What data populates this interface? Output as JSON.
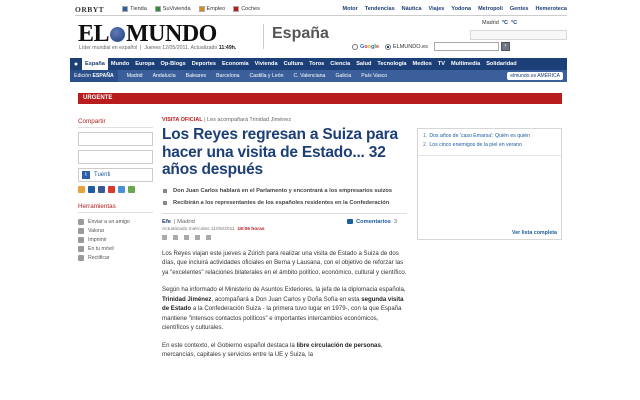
{
  "topbar": {
    "brand": "ORBYT",
    "network": [
      {
        "label": "Tienda",
        "color": "#2f5ea8"
      },
      {
        "label": "SuVivienda",
        "color": "#2f8a3d"
      },
      {
        "label": "Empleo",
        "color": "#d68a1a"
      },
      {
        "label": "Coches",
        "color": "#b81c1c"
      }
    ],
    "links": [
      "Motor",
      "Tendencias",
      "Náutica",
      "Viajes",
      "Yodona",
      "Metropoli",
      "Gentes",
      "Hemeroteca"
    ]
  },
  "masthead": {
    "logo_left": "EL",
    "logo_right": "MUNDO",
    "tagline": "Líder mundial en español",
    "date_text": "Jueves 12/05/2011. Actualizado",
    "time": "11:49h.",
    "section": "España",
    "weather_city": "Madrid",
    "weather_max": "°C",
    "weather_min": "°C",
    "search_google": "Google",
    "search_site": "ELMUNDO.es"
  },
  "mainnav": {
    "items": [
      "España",
      "Mundo",
      "Europa",
      "Op-Blogs",
      "Deportes",
      "Economía",
      "Vivienda",
      "Cultura",
      "Toros",
      "Ciencia",
      "Salud",
      "Tecnología",
      "Medios",
      "TV",
      "Multimedia",
      "Solidaridad"
    ],
    "active_index": 0
  },
  "subnav": {
    "edicion_label": "Edición",
    "edicion_value": "ESPAÑA",
    "items": [
      "Madrid",
      "Andalucía",
      "Baleares",
      "Barcelona",
      "Castilla y León",
      "C. Valenciana",
      "Galicia",
      "País Vasco"
    ],
    "america": "elmundo.es AMÉRICA"
  },
  "urgente": "URGENTE",
  "sidebar": {
    "share_heading": "Compartir",
    "tuenti": "Tuenti",
    "share_icon_colors": [
      "#e8a33d",
      "#1d5da0",
      "#3b5998",
      "#d93a2b",
      "#4a90d9",
      "#6aa84f"
    ],
    "tools_heading": "Herramientas",
    "tools": [
      "Enviar a un amigo",
      "Valorar",
      "Imprimir",
      "En tu móvil",
      "Rectificar"
    ]
  },
  "article": {
    "kicker": "VISITA OFICIAL",
    "kicker_sub": "| Les acompañará Trinidad Jiménez",
    "headline": "Los Reyes regresan a Suiza para hacer una visita de Estado... 32 años después",
    "bullets": [
      "Don Juan Carlos hablará en el Parlamento y encontrará a los empresarios suizos",
      "Recibirán a los representantes de los españoles residentes en la Confederación"
    ],
    "agency": "Efe",
    "place": "| Madrid",
    "comments_label": "Comentarios",
    "comments_count": "3",
    "updated_prefix": "Actualizado miércoles 11/05/2011",
    "updated_time": "18:06 horas",
    "p1": "Los Reyes viajan este jueves a Zúrich para realizar una visita de Estado a Suiza de dos días, que incluirá actividades oficiales en Berna y Lausana, con el objetivo de reforzar las ya \"excelentes\" relaciones bilaterales en el ámbito político, económico, cultural y científico.",
    "p2_a": "Según ha informado el Ministerio de Asuntos Exteriores, la jefa de la diplomacia española, ",
    "p2_b": "Trinidad Jiménez",
    "p2_c": ", acompañará a Don Juan Carlos y Doña Sofía en esta ",
    "p2_d": "segunda visita de Estado",
    "p2_e": " a la Confederación Suiza - la primera tuvo lugar en 1979-, con la que España mantiene \"intensos contactos políticos\" e importantes intercambios económicos, científicos y culturales.",
    "p3_a": "En este contexto, el Gobierno español destaca la ",
    "p3_b": "libre circulación de personas",
    "p3_c": ", mercancías, capitales y servicios entre la UE y Suiza, la"
  },
  "related": {
    "items": [
      {
        "n": "1.",
        "text": "Dos años de 'caso Emarsa': Quién es quién"
      },
      {
        "n": "2.",
        "text": "Los cinco enemigos de la piel en verano"
      }
    ],
    "more": "Ver lista completa"
  }
}
